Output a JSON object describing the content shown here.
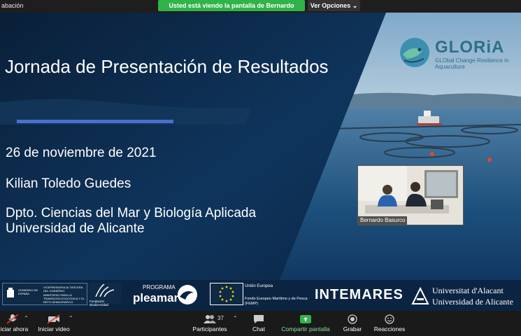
{
  "topbar": {
    "recording_text": "abación",
    "share_banner": "Usted está viendo la pantalla de Bernardo Basurco",
    "view_options": "Ver Opciones ⌄"
  },
  "slide": {
    "title": "Jornada de Presentación de Resultados",
    "date": "26 de noviembre de 2021",
    "speaker": "Kilian Toledo Guedes",
    "department": "Dpto. Ciencias del Mar y Biología Aplicada",
    "university": "Universidad de Alicante",
    "logo": {
      "title": "GLORiA",
      "subtitle": "GLObal Change Resilience in Aquaculture"
    },
    "video_tile": {
      "name": "Bernardo Basurco"
    },
    "sponsors": {
      "gobierno": "GOBIERNO DE ESPAÑA",
      "vicepresidencia": "VICEPRESIDENCIA TERCERA DEL GOBIERNO",
      "ministerio": "MINISTERIO PARA LA TRANSICIÓN ECOLÓGICA Y EL RETO DEMOGRÁFICO",
      "fundacion": "Fundación Biodiversidad",
      "programa": "PROGRAMA",
      "pleamar": "pleamar",
      "ue_title": "Unión Europea",
      "ue_fund": "Fondo Europeo Marítimo y de Pesca (FEMP)",
      "intemares": "INTEMARES",
      "ua_val": "Universitat d'Alacant",
      "ua_es": "Universidad de Alicante"
    }
  },
  "toolbar": {
    "items": [
      {
        "label": "niciar ahora"
      },
      {
        "label": "Iniciar video"
      },
      {
        "label": "Participantes",
        "count": "37"
      },
      {
        "label": "Chat"
      },
      {
        "label": "Compartir pantalla"
      },
      {
        "label": "Grabar"
      },
      {
        "label": "Reacciones"
      }
    ]
  },
  "colors": {
    "share_green": "#31b34a",
    "toolbar_bg": "#1a1a1a",
    "accent_bar": "#4a6fd0",
    "logo_teal": "#2e6f8a"
  }
}
